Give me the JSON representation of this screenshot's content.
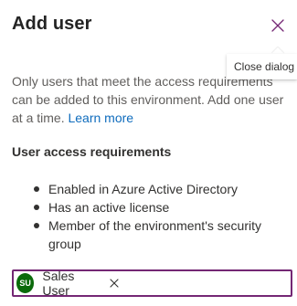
{
  "dialog": {
    "title": "Add user",
    "close_tooltip": "Close dialog",
    "description": "Only users that meet the access requirements can be added to this environment. Add one user at a time.",
    "learn_more_label": "Learn more",
    "requirements_title": "User access requirements",
    "requirements": [
      "Enabled in Azure Active Directory",
      "Has an active license",
      "Member of the environment's security group"
    ]
  },
  "people_picker": {
    "selected": [
      {
        "initials": "SU",
        "name": "Sales User",
        "avatar_color": "#0b6a0b"
      }
    ],
    "input_value": "",
    "border_color": "#742774"
  },
  "colors": {
    "link": "#0f6cbd",
    "close_icon": "#742774"
  },
  "icons": {
    "close": "close-icon",
    "remove": "remove-icon"
  }
}
